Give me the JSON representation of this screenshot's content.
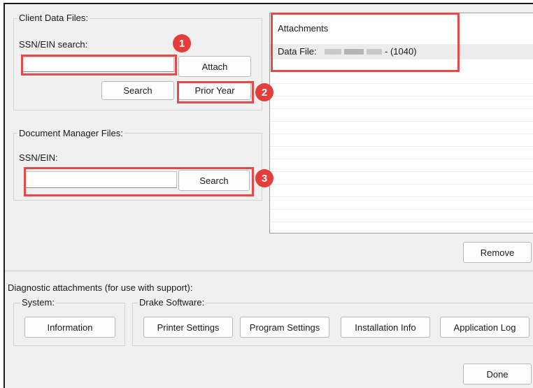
{
  "client_data": {
    "legend": "Client Data Files:",
    "ssn_label": "SSN/EIN search:",
    "ssn_value": "",
    "attach_label": "Attach",
    "search_label": "Search",
    "prior_year_label": "Prior Year"
  },
  "document_manager": {
    "legend": "Document Manager Files:",
    "ssn_label": "SSN/EIN:",
    "ssn_value": "",
    "search_label": "Search"
  },
  "attachments": {
    "header": "Attachments",
    "rows": [
      {
        "prefix": "Data File:",
        "suffix": "- (1040)"
      }
    ],
    "remove_label": "Remove"
  },
  "diagnostics": {
    "heading": "Diagnostic attachments (for use with support):",
    "system_legend": "System:",
    "information_label": "Information",
    "drake_legend": "Drake Software:",
    "printer_settings_label": "Printer Settings",
    "program_settings_label": "Program Settings",
    "installation_info_label": "Installation Info",
    "application_log_label": "Application Log"
  },
  "footer": {
    "done_label": "Done"
  },
  "callouts": {
    "one": "1",
    "two": "2",
    "three": "3"
  },
  "colors": {
    "highlight": "#e34a4a",
    "badge": "#e43d3a",
    "window_bg": "#f0f0f0"
  }
}
